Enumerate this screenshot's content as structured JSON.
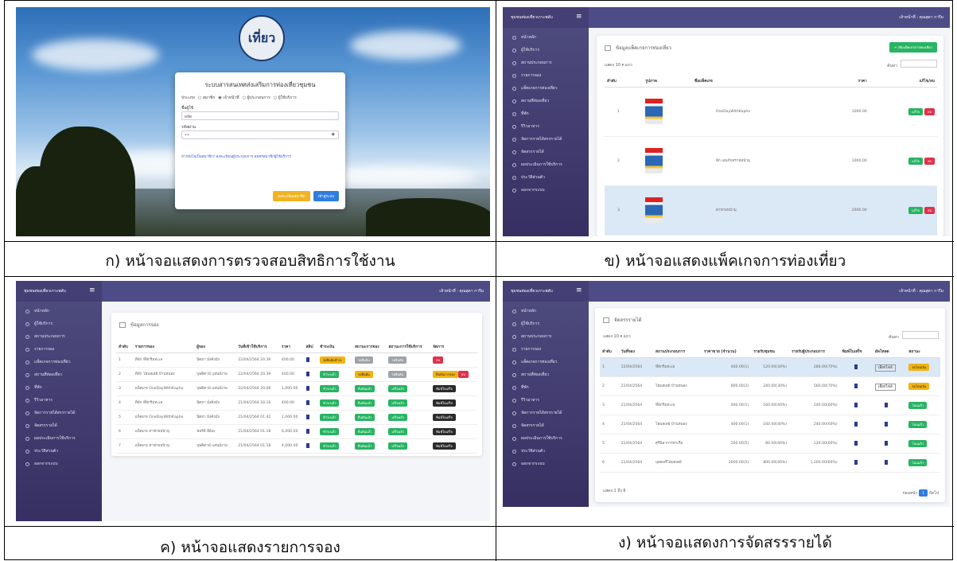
{
  "captions": {
    "a": "ก) หน้าจอแสดงการตรวจสอบสิทธิการใช้งาน",
    "b": "ข) หน้าจอแสดงแพ็คเกจการท่องเที่ยว",
    "c": "ค) หน้าจอแสดงรายการจอง",
    "d": "ง) หน้าจอแสดงการจัดสรรรายได้"
  },
  "login": {
    "title": "ระบบสารสนเทศส่งเสริมการท่องเที่ยวชุมชน",
    "roles": [
      "ประเภท",
      "สมาชิก",
      "เจ้าหน้าที่",
      "ผู้ประกอบการ",
      "ผู้ใช้บริการ"
    ],
    "user_label": "ชื่อผู้ใช้",
    "user_value": "ผจัด",
    "pass_label": "รหัสผ่าน",
    "pass_value": "••",
    "link": "หากยังไม่เป็นสมาชิก? ลงทะเบียนผู้ประกอบการ สมัครสมาชิกผู้ใช้บริการ",
    "btn_register": "ลงทะเบียนสมาชิก",
    "btn_login": "เข้าสู่ระบบ"
  },
  "admin": {
    "brand": "ชุมชนท่องเที่ยวเกาะพลับ",
    "user": "เจ้าหน้าที่ : คุณสุดา การีม",
    "menu": [
      "หน้าหลัก",
      "ผู้ใช้บริการ",
      "สถานประกอบการ",
      "รายการจอง",
      "แพ็คเกจการท่องเที่ยว",
      "สถานที่ท่องเที่ยว",
      "ที่พัก",
      "รีวิวอาหาร",
      "จัดการรายได้สรรรายได้",
      "จัดสรรรายได้",
      "ผลประเมินการใช้บริการ",
      "ประวัติส่วนตัว",
      "ออกจากระบบ"
    ]
  },
  "pkg": {
    "title": "ข้อมูลแพ็คเกจการท่องเที่ยว",
    "add_btn": "+ เพิ่มแพ็คเกจการท่องเที่ยว",
    "show": "แสดง 10 ▾ แถว",
    "search": "ค้นหา",
    "headers": [
      "ลำดับ",
      "รูปภาพ",
      "ชื่อแพ็คเกจ",
      "ราคา",
      "แก้ไข/ลบ"
    ],
    "rows": [
      {
        "no": "1",
        "name": "OneDayWithKapho",
        "price": "1000.00"
      },
      {
        "no": "2",
        "name": "พัก เลนกับทรายหน้ามุ",
        "price": "1000.00"
      },
      {
        "no": "3",
        "name": "ท่าช่ายหน้ามุ",
        "price": "2000.00"
      }
    ],
    "edit": "แก้ไข",
    "del": "ลบ"
  },
  "booking": {
    "title": "ข้อมูลการจอง",
    "headers": [
      "ลำดับ",
      "รายการจอง",
      "ผู้จอง",
      "วันที่เข้าใช้บริการ",
      "ราคา",
      "สลิป",
      "ชำระเงิน",
      "สถานะการจอง",
      "สถานะการใช้บริการ",
      "จัดการ"
    ],
    "rows": [
      {
        "no": "1",
        "item": "ที่พัก ที่พักริมทะเล",
        "who": "นิตยา มั่งคั่งมั่ง",
        "date": "22/04/2564 20.39",
        "price": "400.00",
        "pay": "รอยืนยันชำระ",
        "pc": "y",
        "bs": "รอยืนยัน",
        "bc": "gr",
        "us": "รอยืนยัน",
        "uc": "gr",
        "act": "ลบ",
        "ac": "r"
      },
      {
        "no": "2",
        "item": "ที่พัก โฮมสเตย์ บ้านหนอง",
        "who": "บุษดิตาน์ แสนมั่งาม",
        "date": "22/04/2564 20.39",
        "price": "400.00",
        "pay": "ชำระแล้ว",
        "pc": "g",
        "bs": "รอยืนยัน",
        "bc": "y",
        "us": "รอยืนยัน",
        "uc": "gr",
        "act": "ยืนยันการจอง",
        "ac": "y"
      },
      {
        "no": "3",
        "item": "แพ็คเกจ OneDayWithKapho",
        "who": "บุษดิตาน์ แสนมั่งาม",
        "date": "22/04/2564 20.09",
        "price": "1,000.00",
        "pay": "ชำระแล้ว",
        "pc": "g",
        "bs": "ยืนยันแล้ว",
        "bc": "g",
        "us": "เสร็จแล้ว",
        "uc": "g",
        "act": "พิมพ์ใบเสร็จ",
        "ac": "k"
      },
      {
        "no": "4",
        "item": "ที่พัก ที่พักริมทะเล",
        "who": "นิตยา มั่งคั่งมั่ง",
        "date": "21/04/2564 18.16",
        "price": "400.00",
        "pay": "ชำระแล้ว",
        "pc": "g",
        "bs": "ยืนยันแล้ว",
        "bc": "g",
        "us": "เสร็จแล้ว",
        "uc": "g",
        "act": "พิมพ์ใบเสร็จ",
        "ac": "k"
      },
      {
        "no": "5",
        "item": "แพ็คเกจ OneDayWithKapho",
        "who": "นิตยา มั่งคั่งมั่ง",
        "date": "21/04/2564 01.42",
        "price": "1,000.00",
        "pay": "ชำระแล้ว",
        "pc": "g",
        "bs": "ยืนยันแล้ว",
        "bc": "g",
        "us": "เสร็จแล้ว",
        "uc": "g",
        "act": "พิมพ์ใบเสร็จ",
        "ac": "k"
      },
      {
        "no": "6",
        "item": "แพ็คเกจ ท่าช่ายหน้ามุ",
        "who": "ฟอร์ดี ฮีย์เย",
        "date": "21/04/2564 01.18",
        "price": "6,000.00",
        "pay": "ชำระแล้ว",
        "pc": "g",
        "bs": "ยืนยันแล้ว",
        "bc": "g",
        "us": "เสร็จแล้ว",
        "uc": "g",
        "act": "พิมพ์ใบเสร็จ",
        "ac": "k"
      },
      {
        "no": "7",
        "item": "แพ็คเกจ ท่าช่ายหน้ามุ",
        "who": "บุษดิตาน์ แสนมั่งาม",
        "date": "21/04/2564 01.18",
        "price": "4,000.00",
        "pay": "ชำระแล้ว",
        "pc": "g",
        "bs": "ยืนยันแล้ว",
        "bc": "g",
        "us": "เสร็จแล้ว",
        "uc": "g",
        "act": "พิมพ์ใบเสร็จ",
        "ac": "k"
      }
    ]
  },
  "income": {
    "title": "จัดสรรรายได้",
    "show": "แสดง 10 ▾ แถว",
    "search": "ค้นหา",
    "headers": [
      "ลำดับ",
      "วันที่จอง",
      "สถานประกอบการ",
      "ราคาขาย (จำนวน)",
      "รายรับชุมชน",
      "รายรับผู้ประกอบการ",
      "พิมพ์ใบเสร็จ",
      "อัพโหลด",
      "สถานะ"
    ],
    "rows": [
      {
        "no": "1",
        "date": "22/04/2564",
        "biz": "ที่พักริมทะเล",
        "sale": "400.00(1)",
        "com": "120.00(30%)",
        "own": "280.00(70%)",
        "up": "เลือกไฟล์",
        "st": "รอโอนเงิน",
        "sc": "y"
      },
      {
        "no": "2",
        "date": "22/04/2564",
        "biz": "โฮมสเตย์ บ้านหนอง",
        "sale": "800.00(2)",
        "com": "240.00(30%)",
        "own": "560.00(70%)",
        "up": "เลือกไฟล์",
        "st": "รอโอนเงิน",
        "sc": "y"
      },
      {
        "no": "3",
        "date": "21/04/2564",
        "biz": "ที่พักริมทะเล",
        "sale": "400.00(1)",
        "com": "160.00(40%)",
        "own": "240.00(60%)",
        "up": "",
        "st": "โอนแล้ว",
        "sc": "g"
      },
      {
        "no": "4",
        "date": "21/04/2564",
        "biz": "โฮมสเตย์ บ้านหนอง",
        "sale": "400.00(1)",
        "com": "160.00(40%)",
        "own": "240.00(60%)",
        "up": "",
        "st": "โอนแล้ว",
        "sc": "g"
      },
      {
        "no": "5",
        "date": "21/04/2564",
        "biz": "ศรีนิลาการท่าเรือ",
        "sale": "200.00(5)",
        "com": "80.00(40%)",
        "own": "120.00(60%)",
        "up": "",
        "st": "โอนแล้ว",
        "sc": "g"
      },
      {
        "no": "6",
        "date": "21/04/2564",
        "biz": "บุคคลรีโฮมสเตย์",
        "sale": "2000.00(5)",
        "com": "800.00(40%)",
        "own": "1,200.00(60%)",
        "up": "",
        "st": "โอนแล้ว",
        "sc": "g"
      }
    ],
    "footer": "แสดง 1 ถึง 6",
    "pager": [
      "ก่อนหน้า",
      "1",
      "ถัดไป"
    ]
  }
}
